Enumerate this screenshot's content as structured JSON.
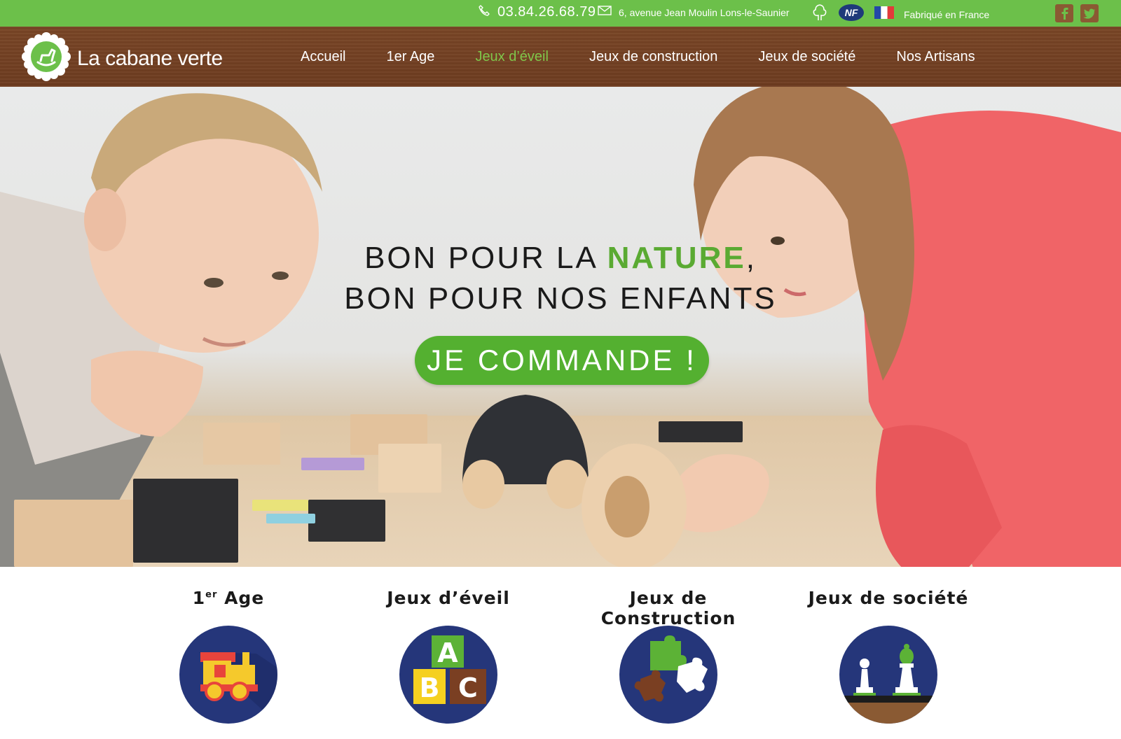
{
  "topbar": {
    "phone": "03.84.26.68.79",
    "address": "6, avenue Jean Moulin  Lons-le-Saunier",
    "nf_badge": "NF",
    "made_in": "Fabriqué en France",
    "icons": [
      "phone-icon",
      "mail-icon",
      "tree-icon",
      "nf-logo",
      "french-flag-icon",
      "facebook-icon",
      "twitter-icon"
    ]
  },
  "brand": {
    "name": "La cabane verte"
  },
  "nav": {
    "items": [
      {
        "label": "Accueil",
        "active": false
      },
      {
        "label": "1er Age",
        "active": false
      },
      {
        "label": "Jeux d’éveil",
        "active": true
      },
      {
        "label": "Jeux de construction",
        "active": false
      },
      {
        "label": "Jeux de société",
        "active": false
      },
      {
        "label": "Nos Artisans",
        "active": false
      }
    ]
  },
  "hero": {
    "line1_prefix": "BON POUR LA ",
    "line1_accent": "NATURE",
    "line1_suffix": ",",
    "line2": "BON POUR NOS ENFANTS",
    "cta": "JE COMMANDE !"
  },
  "categories": [
    {
      "title": "1",
      "title_sup": "er",
      "title_rest": " Age",
      "icon": "toy-train-icon"
    },
    {
      "title": "Jeux d’éveil",
      "icon": "abc-blocks-icon"
    },
    {
      "title": "Jeux de Construction",
      "icon": "puzzle-pieces-icon"
    },
    {
      "title": "Jeux de société",
      "icon": "chess-pieces-icon"
    }
  ],
  "colors": {
    "topbar_green": "#6cc04a",
    "nav_wood": "#74411f",
    "nav_active": "#7fc64a",
    "accent_green": "#54b030",
    "category_circle": "#25367a"
  }
}
